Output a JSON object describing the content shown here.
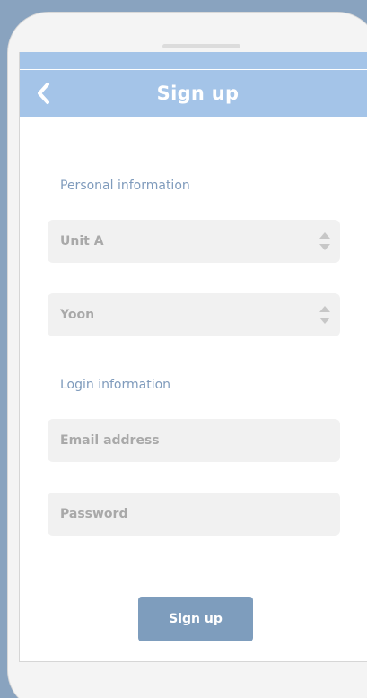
{
  "header": {
    "title": "Sign up",
    "back_icon": "chevron-left-icon"
  },
  "personal": {
    "section_label": "Personal information",
    "unit_value": "Unit A",
    "name_value": "Yoon"
  },
  "login": {
    "section_label": "Login information",
    "email_placeholder": "Email address",
    "password_placeholder": "Password"
  },
  "actions": {
    "signup_label": "Sign up"
  },
  "colors": {
    "background": "#89a3bf",
    "header": "#a4c4e8",
    "accent_text": "#7f9bbc",
    "button": "#7e9dbd",
    "field": "#f1f1f1"
  }
}
